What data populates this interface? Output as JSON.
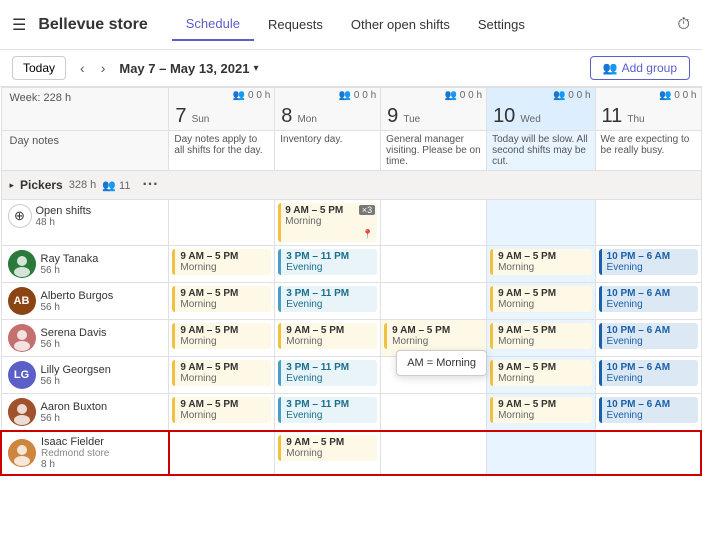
{
  "app": {
    "store_name": "Bellevue store",
    "nav": [
      "Schedule",
      "Requests",
      "Other open shifts",
      "Settings"
    ],
    "active_nav": "Schedule",
    "history_icon": "⏱"
  },
  "toolbar": {
    "today": "Today",
    "date_range": "May 7 – May 13, 2021",
    "add_group": "Add group"
  },
  "week_label": "Week: 228 h",
  "day_notes_label": "Day notes",
  "days": [
    {
      "num": "7",
      "name": "Sun",
      "people": "0",
      "hours": "0 h",
      "note": "Day notes apply to all shifts for the day."
    },
    {
      "num": "8",
      "name": "Mon",
      "people": "0",
      "hours": "0 h",
      "note": "Inventory day."
    },
    {
      "num": "9",
      "name": "Tue",
      "people": "0",
      "hours": "0 h",
      "note": "General manager visiting. Please be on time."
    },
    {
      "num": "10",
      "name": "Wed",
      "people": "0",
      "hours": "0 h",
      "note": "Today will be slow. All second shifts may be cut."
    },
    {
      "num": "11",
      "name": "Thu",
      "people": "0",
      "hours": "0 h",
      "note": "We are expecting to be really busy."
    }
  ],
  "pickers": {
    "label": "Pickers",
    "hours": "328 h",
    "people": "11"
  },
  "open_shifts": {
    "label": "Open shifts",
    "hours": "48 h",
    "shifts": [
      {
        "day": 1,
        "time": "9 AM – 5 PM",
        "label": "Morning",
        "count": "×3"
      }
    ]
  },
  "employees": [
    {
      "name": "Ray Tanaka",
      "hours": "56 h",
      "avatar_initials": "RT",
      "avatar_class": "avatar-rt",
      "avatar_img": "photo",
      "shifts": [
        {
          "day": 0,
          "time": "9 AM – 5 PM",
          "label": "Morning",
          "type": "morning"
        },
        {
          "day": 1,
          "time": "3 PM – 11 PM",
          "label": "Evening",
          "type": "evening"
        },
        {
          "day": 3,
          "time": "9 AM – 5 PM",
          "label": "Morning",
          "type": "morning"
        },
        {
          "day": 4,
          "time": "10 PM – 6 AM",
          "label": "Evening",
          "type": "evening"
        }
      ]
    },
    {
      "name": "Alberto Burgos",
      "hours": "56 h",
      "avatar_initials": "AB",
      "avatar_class": "avatar-ab",
      "shifts": [
        {
          "day": 0,
          "time": "9 AM – 5 PM",
          "label": "Morning",
          "type": "morning"
        },
        {
          "day": 1,
          "time": "3 PM – 11 PM",
          "label": "Evening",
          "type": "evening"
        },
        {
          "day": 3,
          "time": "9 AM – 5 PM",
          "label": "Morning",
          "type": "morning"
        },
        {
          "day": 4,
          "time": "10 PM – 6 AM",
          "label": "Evening",
          "type": "evening"
        }
      ]
    },
    {
      "name": "Serena Davis",
      "hours": "56 h",
      "avatar_initials": "SD",
      "avatar_class": "avatar-sd",
      "shifts": [
        {
          "day": 0,
          "time": "9 AM – 5 PM",
          "label": "Morning",
          "type": "morning"
        },
        {
          "day": 1,
          "time": "9 AM – 5 PM",
          "label": "Morning",
          "type": "morning"
        },
        {
          "day": 2,
          "time": "9 AM – 5 PM",
          "label": "Morning",
          "type": "morning"
        },
        {
          "day": 3,
          "time": "9 AM – 5 PM",
          "label": "Morning",
          "type": "morning"
        },
        {
          "day": 4,
          "time": "10 PM – 6 AM",
          "label": "Evening",
          "type": "evening"
        }
      ]
    },
    {
      "name": "Lilly Georgsen",
      "hours": "56 h",
      "avatar_initials": "LG",
      "avatar_class": "avatar-lg",
      "shifts": [
        {
          "day": 0,
          "time": "9 AM – 5 PM",
          "label": "Morning",
          "type": "morning"
        },
        {
          "day": 1,
          "time": "3 PM – 11 PM",
          "label": "Evening",
          "type": "evening"
        },
        {
          "day": 3,
          "time": "9 AM – 5 PM",
          "label": "Morning",
          "type": "morning"
        },
        {
          "day": 4,
          "time": "10 PM – 6 AM",
          "label": "Evening",
          "type": "evening"
        }
      ]
    },
    {
      "name": "Aaron Buxton",
      "hours": "56 h",
      "avatar_initials": "AX",
      "avatar_class": "avatar-ax",
      "avatar_img": "photo",
      "shifts": [
        {
          "day": 0,
          "time": "9 AM – 5 PM",
          "label": "Morning",
          "type": "morning"
        },
        {
          "day": 1,
          "time": "3 PM – 11 PM",
          "label": "Evening",
          "type": "evening"
        },
        {
          "day": 3,
          "time": "9 AM – 5 PM",
          "label": "Morning",
          "type": "morning"
        },
        {
          "day": 4,
          "time": "10 PM – 6 AM",
          "label": "Evening",
          "type": "evening"
        }
      ]
    },
    {
      "name": "Isaac Fielder",
      "sub": "Redmond store",
      "hours": "8 h",
      "avatar_initials": "IF",
      "avatar_class": "avatar-if",
      "avatar_img": "photo",
      "highlighted": true,
      "shifts": [
        {
          "day": 1,
          "time": "9 AM – 5 PM",
          "label": "Morning",
          "type": "morning"
        }
      ]
    }
  ],
  "tooltip": {
    "label": "AM = Morning"
  }
}
